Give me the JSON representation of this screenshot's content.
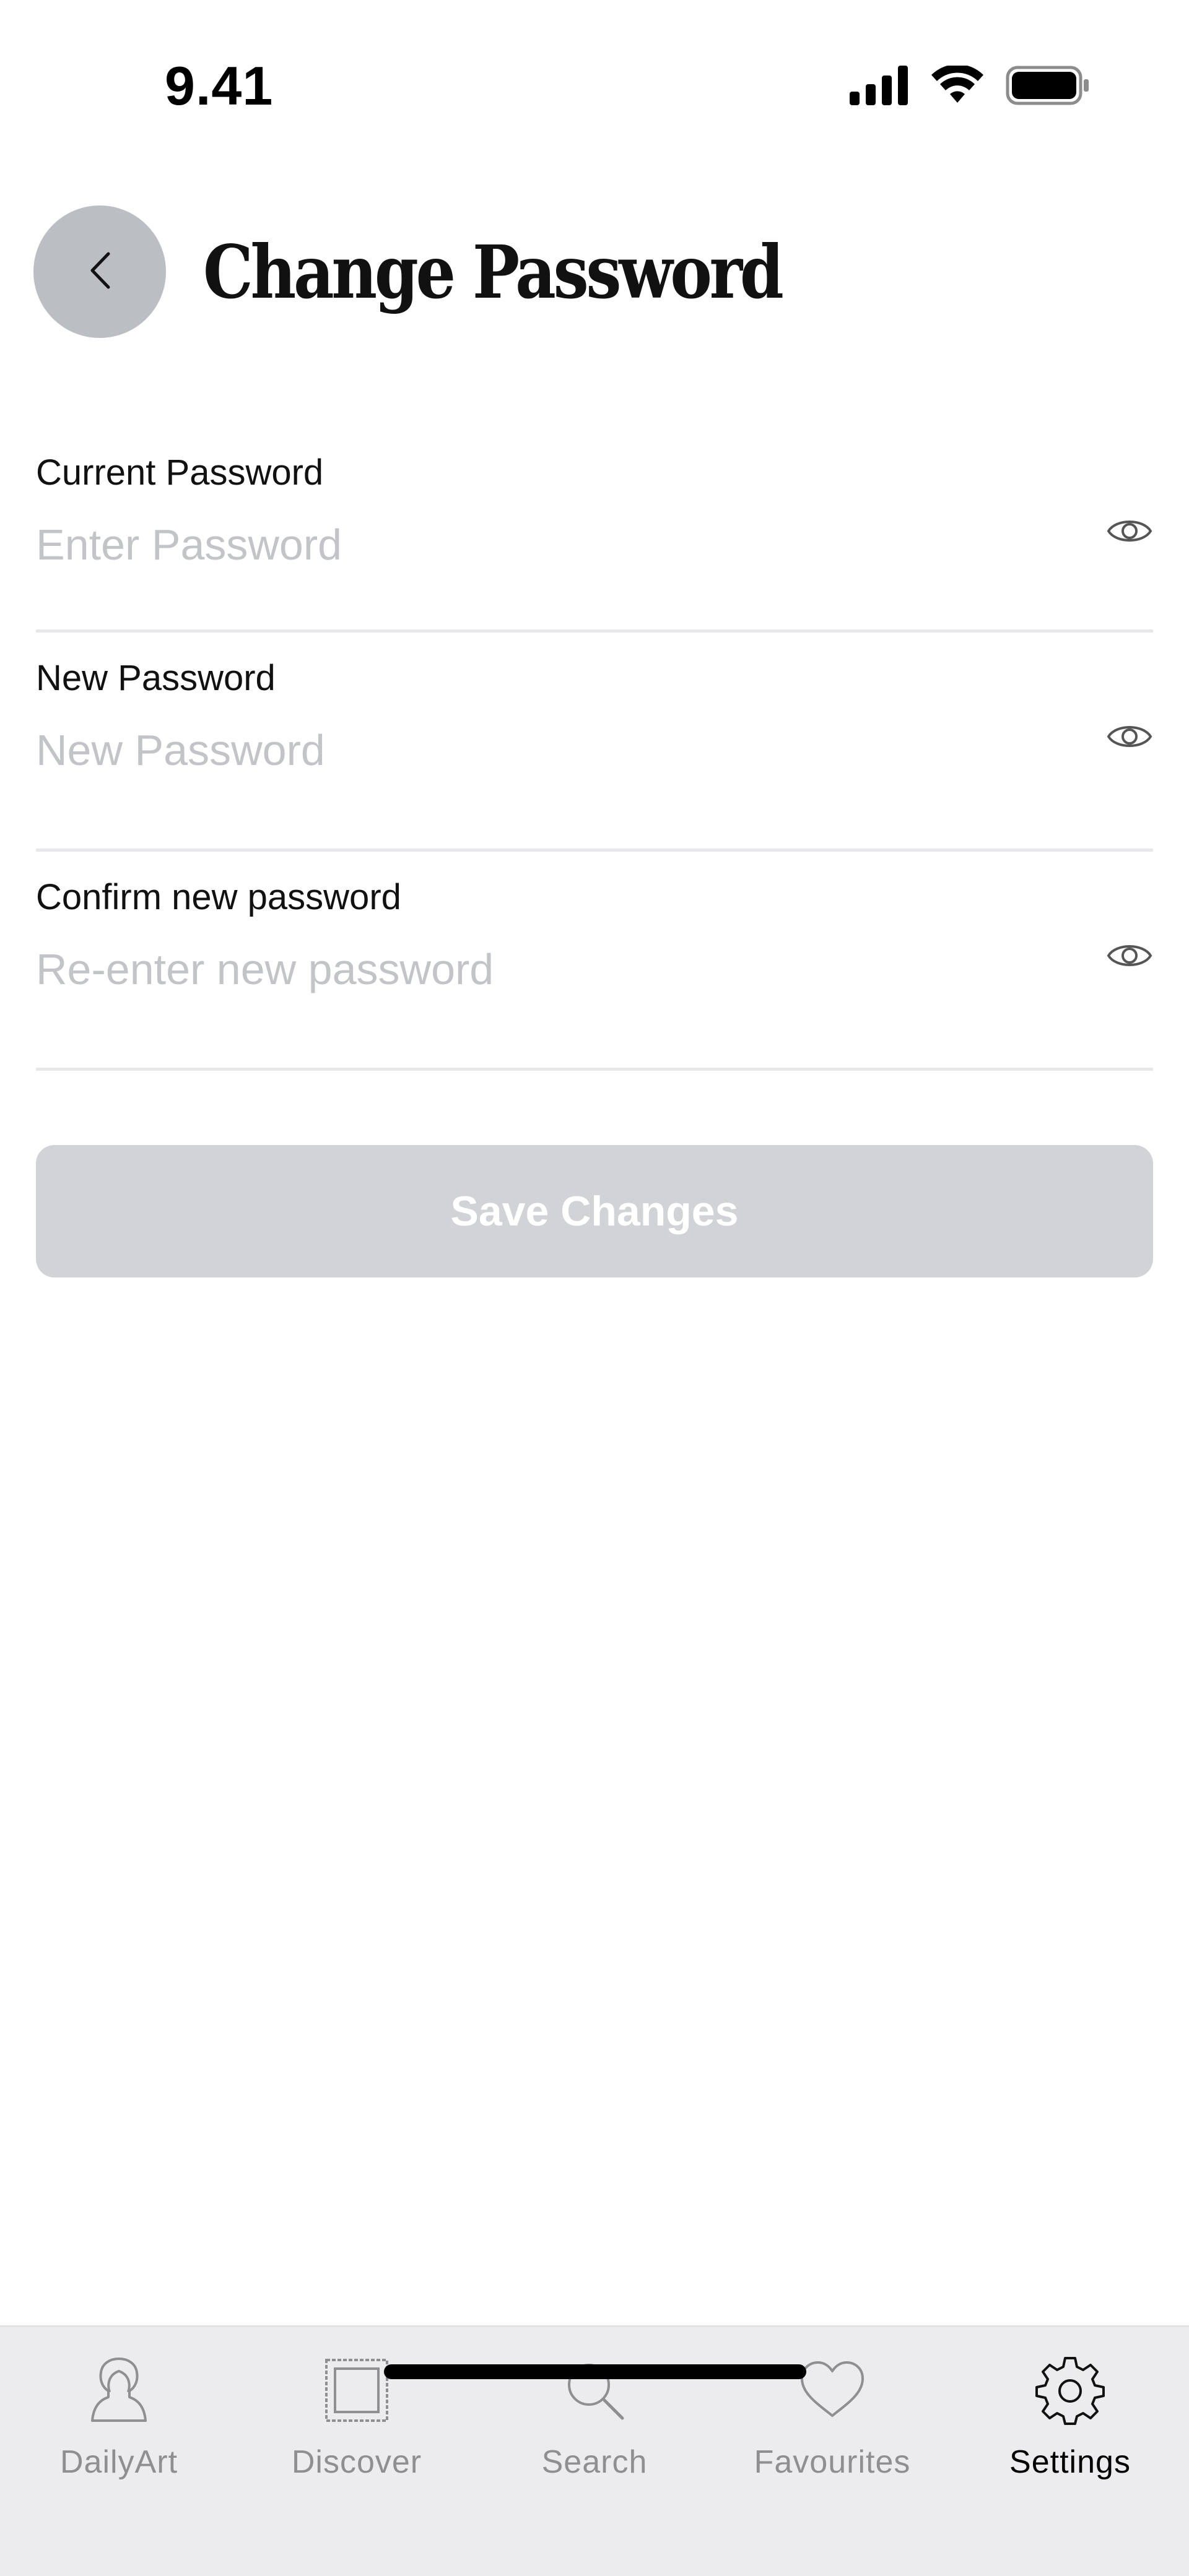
{
  "status_bar": {
    "time": "9.41",
    "icons": [
      "cellular-signal-icon",
      "wifi-icon",
      "battery-icon"
    ]
  },
  "header": {
    "back_icon": "chevron-left-icon",
    "title": "Change Password"
  },
  "form": {
    "fields": [
      {
        "label": "Current Password",
        "placeholder": "Enter Password",
        "value": "",
        "toggle_icon": "eye-icon"
      },
      {
        "label": "New Password",
        "placeholder": "New Password",
        "value": "",
        "toggle_icon": "eye-icon"
      },
      {
        "label": "Confirm new password",
        "placeholder": "Re-enter new password",
        "value": "",
        "toggle_icon": "eye-icon"
      }
    ],
    "save_label": "Save Changes",
    "save_enabled": false
  },
  "tab_bar": {
    "tabs": [
      {
        "label": "DailyArt",
        "icon": "portrait-icon",
        "active": false
      },
      {
        "label": "Discover",
        "icon": "frame-icon",
        "active": false
      },
      {
        "label": "Search",
        "icon": "search-icon",
        "active": false
      },
      {
        "label": "Favourites",
        "icon": "heart-icon",
        "active": false
      },
      {
        "label": "Settings",
        "icon": "gear-icon",
        "active": true
      }
    ]
  },
  "colors": {
    "back_button_bg": "#bbbec3",
    "save_button_bg_disabled": "#d2d3d6",
    "placeholder": "#c3c4c8",
    "tab_bar_bg": "#ececee",
    "tab_inactive": "#8e8e93",
    "tab_active": "#000000"
  }
}
